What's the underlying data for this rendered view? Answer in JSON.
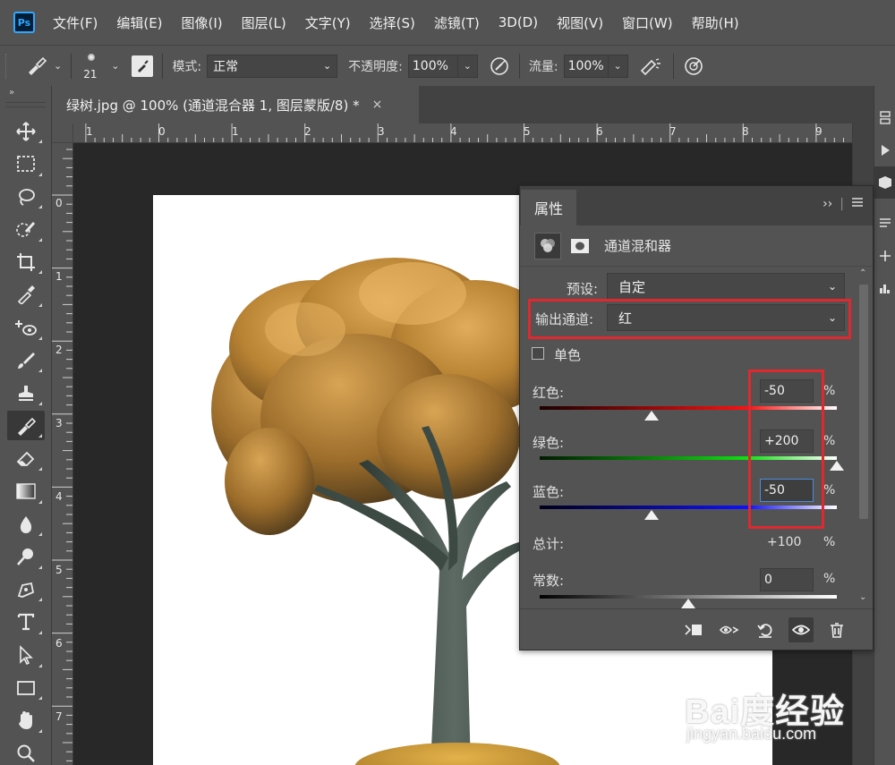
{
  "app": {
    "logo": "Ps"
  },
  "menu": [
    "文件(F)",
    "编辑(E)",
    "图像(I)",
    "图层(L)",
    "文字(Y)",
    "选择(S)",
    "滤镜(T)",
    "3D(D)",
    "视图(V)",
    "窗口(W)",
    "帮助(H)"
  ],
  "options": {
    "brush_size": "21",
    "mode_label": "模式:",
    "mode_value": "正常",
    "opacity_label": "不透明度:",
    "opacity_value": "100%",
    "flow_label": "流量:",
    "flow_value": "100%"
  },
  "document": {
    "tab_title": "绿树.jpg @ 100% (通道混合器 1, 图层蒙版/8) *",
    "close_glyph": "×"
  },
  "rulers": {
    "top": [
      "1",
      "0",
      "1",
      "2",
      "3",
      "4",
      "5",
      "6",
      "7",
      "8",
      "9"
    ],
    "left": [
      "0",
      "1",
      "2",
      "3",
      "4",
      "5",
      "6",
      "7"
    ]
  },
  "properties": {
    "tab_label": "属性",
    "collapse_glyph": "››",
    "adjustment_title": "通道混和器",
    "preset_label": "预设:",
    "preset_value": "自定",
    "output_label": "输出通道:",
    "output_value": "红",
    "mono_label": "单色",
    "mono_checked": false,
    "red_label": "红色:",
    "red_value": "-50",
    "green_label": "绿色:",
    "green_value": "+200",
    "blue_label": "蓝色:",
    "blue_value": "-50",
    "total_label": "总计:",
    "total_value": "+100",
    "constant_label": "常数:",
    "constant_value": "0",
    "pct": "%",
    "slider_levels": {
      "red": -50,
      "green": 200,
      "blue": -50,
      "constant": 0
    }
  },
  "watermark": {
    "brand": "Bai度经验",
    "url": "jingyan.baidu.com"
  },
  "colors": {
    "highlight": "#e0282e",
    "accent": "#31a8ff",
    "panel": "#535353"
  }
}
